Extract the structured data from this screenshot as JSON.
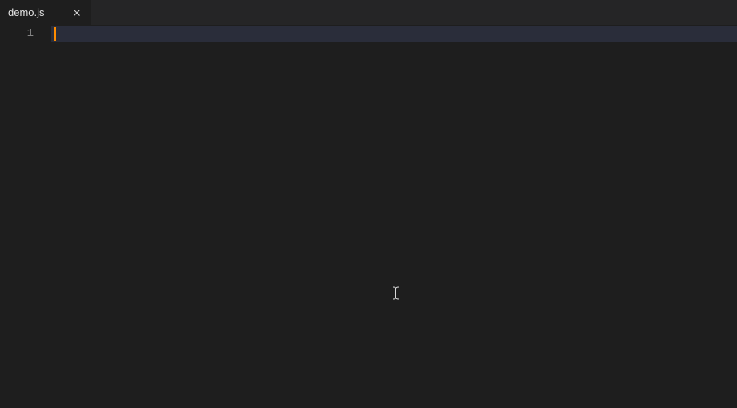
{
  "tabs": [
    {
      "label": "demo.js",
      "active": true
    }
  ],
  "editor": {
    "line_numbers": [
      "1"
    ],
    "lines": [
      ""
    ],
    "cursor_line": 1,
    "colors": {
      "cursor": "#ff8c00",
      "background": "#1e1e1e",
      "tab_bar": "#252526",
      "line_highlight": "#2a2d3a",
      "line_number": "#858585"
    }
  }
}
